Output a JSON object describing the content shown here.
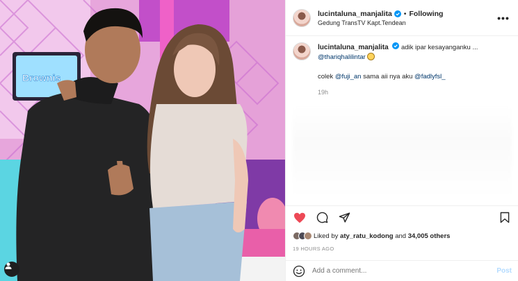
{
  "post": {
    "username": "lucintaluna_manjalita",
    "follow_label": "Following",
    "dot": "•",
    "location": "Gedung TransTV Kapt.Tendean",
    "more_label": "•••"
  },
  "caption": {
    "username": "lucintaluna_manjalita",
    "text": "adik ipar kesayanganku ...",
    "mention1": "@thariqhalilintar",
    "line2_prefix": "colek ",
    "mention2": "@fuji_an",
    "line2_mid": " sama aii nya aku ",
    "mention3": "@fadlyfsl_",
    "time": "19h"
  },
  "photo": {
    "sign_text": "Brownis"
  },
  "likes": {
    "prefix": "Liked by ",
    "user": "aty_ratu_kodong",
    "mid": " and ",
    "count": "34,005 others"
  },
  "posted_ago": "19 HOURS AGO",
  "comment_box": {
    "placeholder": "Add a comment...",
    "post_label": "Post"
  },
  "colors": {
    "liked_heart": "#ed4956",
    "verified": "#0095f6",
    "mention": "#00376b",
    "post_disabled": "#b3dbff"
  },
  "icons": {
    "like": "heart-filled-icon",
    "comment": "comment-bubble-icon",
    "share": "paper-plane-icon",
    "save": "bookmark-icon",
    "emoji": "smiley-icon",
    "options": "ellipsis-icon",
    "tags": "user-tag-icon"
  }
}
